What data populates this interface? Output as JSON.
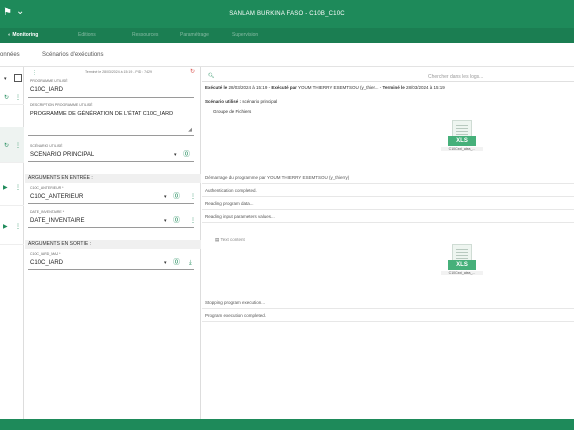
{
  "topbar": {
    "title": "SANLAM BURKINA FASO - C10B_C10C",
    "pin_icon": "pin-icon",
    "chevron_icon": "chevron-down-icon"
  },
  "nav": {
    "items": [
      "Monitoring",
      "Editions",
      "Ressources",
      "Paramétrage",
      "Supervision"
    ],
    "active": "Monitoring"
  },
  "tabs": [
    "onnées",
    "Scénarios d'exécutions"
  ],
  "form": {
    "status_text": "Terminé le 28/03/2024 à 15:19 - PID : 7429",
    "program_label": "PROGRAMME UTILISÉ",
    "program_value": "C10C_IARD",
    "desc_label": "DESCRIPTION PROGRAMME UTILISÉ",
    "desc_value": "PROGRAMME DE GÉNÉRATION DE L'ÉTAT C10C_IARD",
    "scenario_label": "SCÉNARIO UTILISÉ",
    "scenario_value": "SCENARIO PRINCIPAL",
    "args_in_header": "ARGUMENTS EN ENTRÉE :",
    "arg1_label": "C10C_ANTERIEUR *",
    "arg1_value": "C10C_ANTERIEUR",
    "arg2_label": "DATE_INVENTAIRE *",
    "arg2_value": "DATE_INVENTAIRE",
    "args_out_header": "ARGUMENTS EN SORTIE :",
    "arg3_label": "C10C_IARD_MAJ *",
    "arg3_value": "C10C_IARD"
  },
  "log": {
    "search_placeholder": "Chercher dans les logs...",
    "header_executed_label": "Exécuté le",
    "header_executed_date": "28/03/2024 à 15:19",
    "header_by_label": "Exécuté par",
    "header_by_user": "YOUM THIERRY ESEMTSOU (y_thier...",
    "header_done_label": "Terminé le",
    "header_done_date": "28/03/2024 à 15:19",
    "scenario_label": "Scénario utilisé :",
    "scenario_value": "scénario principal",
    "group_label": "Groupe de Fichiers",
    "file1_caption": "C10Cxxi_alea_...",
    "file2_caption": "C10Cxxi_alea_...",
    "xls_label": "XLS",
    "lines": [
      "Démarrage du programme par YOUM THIERRY ESEMTSOU (y_thierry)",
      "Authentication completed.",
      "Reading program data...",
      "Reading input parameters values..."
    ],
    "text_content_label": "Text content",
    "end_lines": [
      "Stopping program execution...",
      "Program execution completed."
    ]
  },
  "colors": {
    "brand": "#1e8a5a",
    "danger": "#d9534f"
  }
}
